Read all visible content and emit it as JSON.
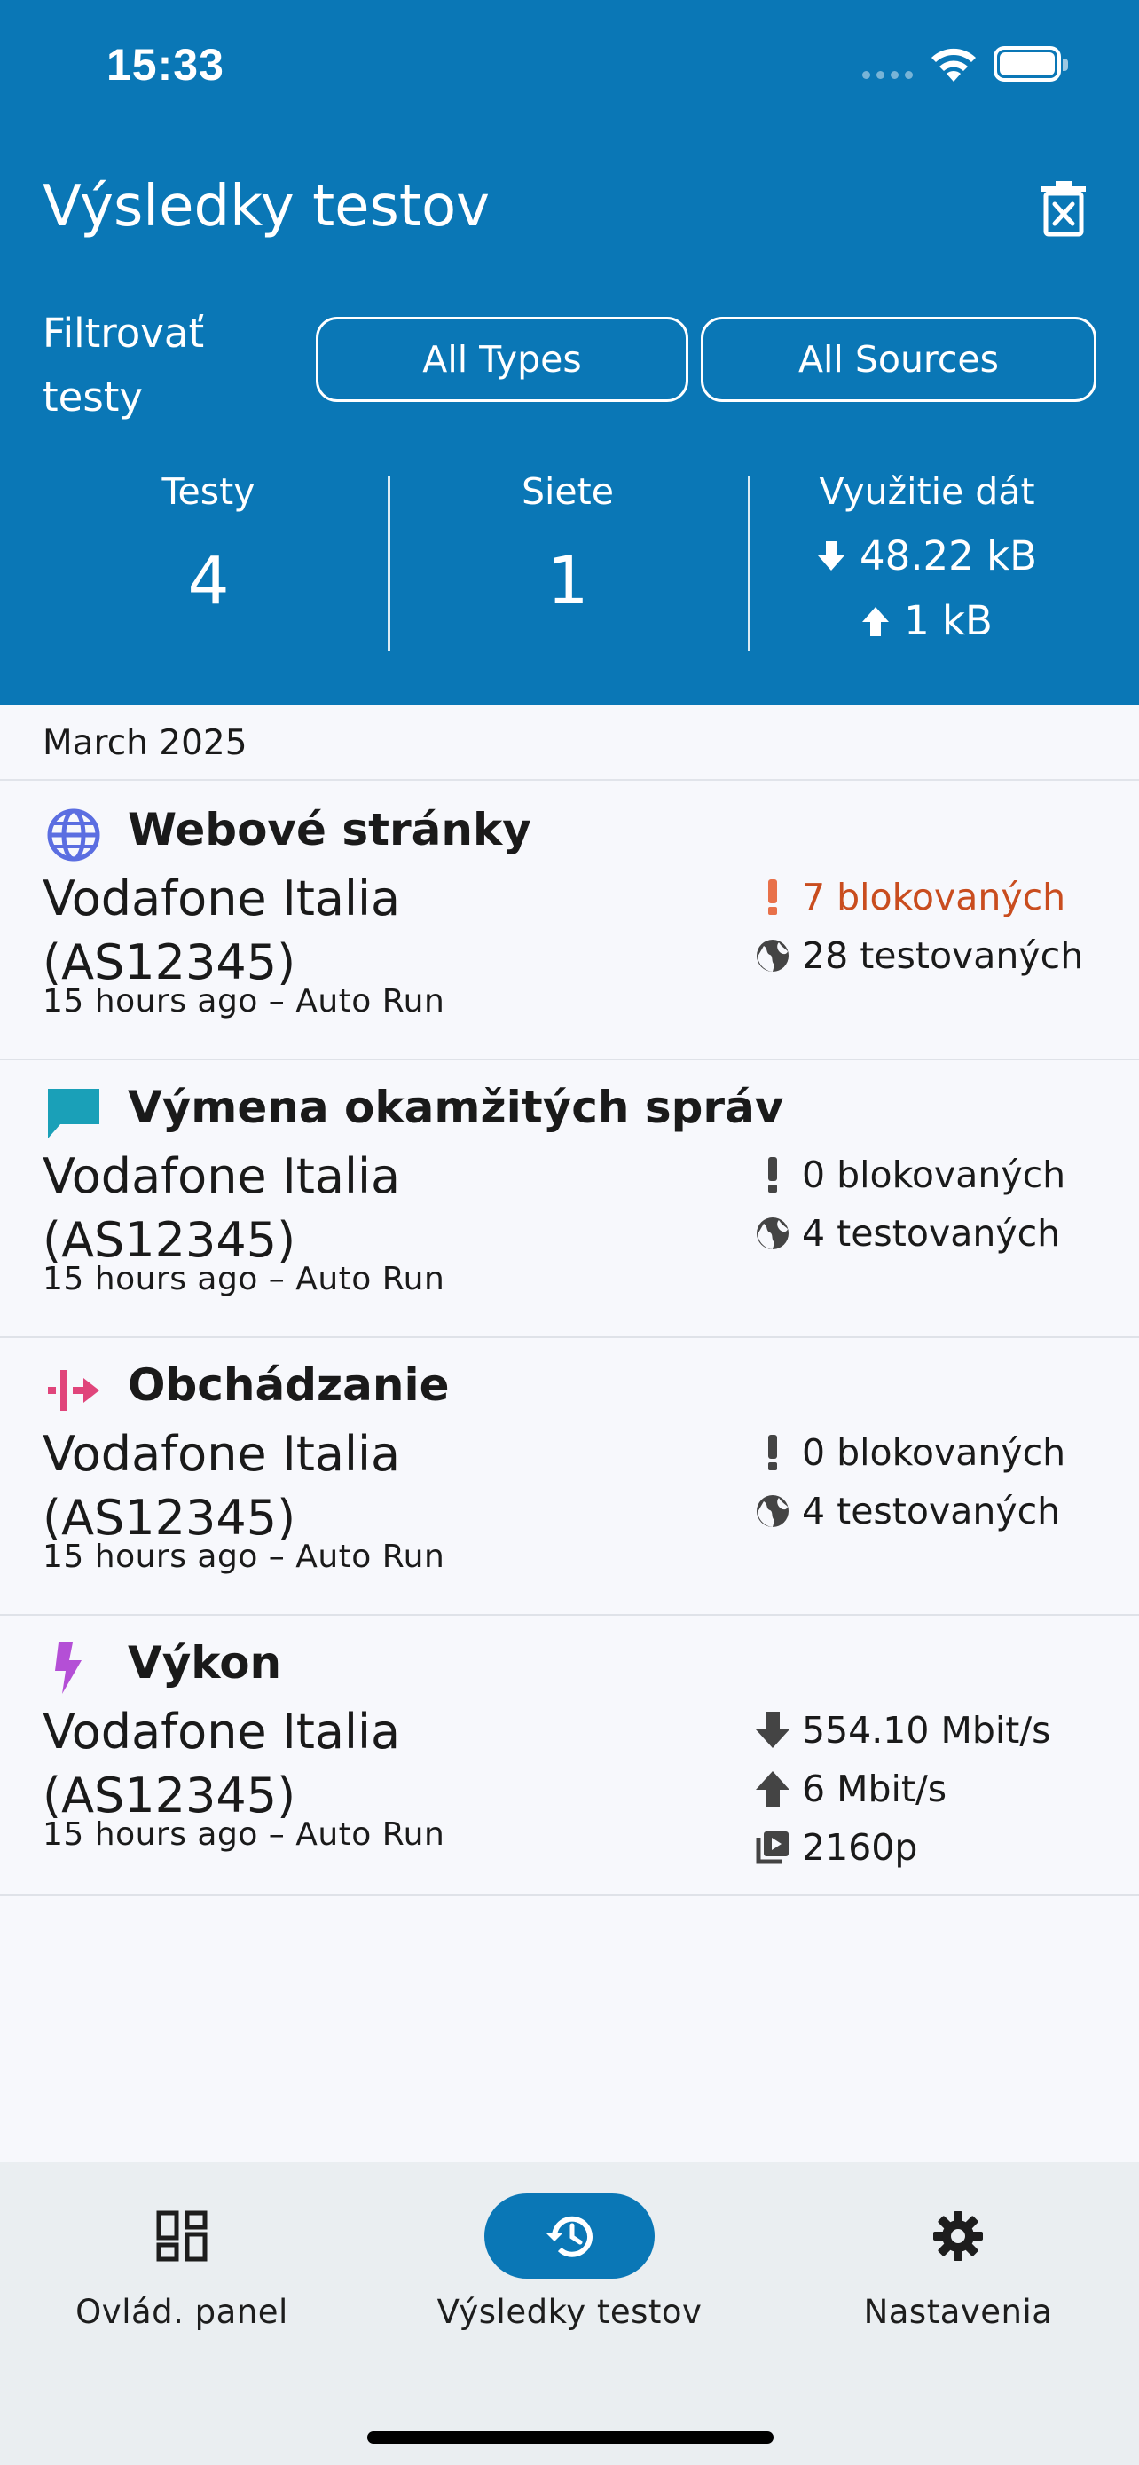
{
  "status_bar": {
    "time": "15:33"
  },
  "header": {
    "title": "Výsledky testov",
    "filter_label": "Filtrovať testy",
    "filter_types": "All Types",
    "filter_sources": "All Sources",
    "stats": {
      "tests_label": "Testy",
      "tests_value": "4",
      "networks_label": "Siete",
      "networks_value": "1",
      "data_label": "Využitie dát",
      "data_download": "48.22 kB",
      "data_upload": "1 kB"
    }
  },
  "month_header": "March 2025",
  "results": [
    {
      "icon": "globe-icon",
      "icon_color": "#5b6ee1",
      "title": "Webové stránky",
      "network": "Vodafone Italia (AS12345)",
      "meta": "15 hours ago – Auto Run",
      "metrics": [
        {
          "icon": "exclamation-icon",
          "text": "7 blokovaných",
          "color": "#c94d1f"
        },
        {
          "icon": "world-icon",
          "text": "28 testovaných"
        }
      ]
    },
    {
      "icon": "chat-icon",
      "icon_color": "#1aa0b8",
      "title": "Výmena okamžitých správ",
      "network": "Vodafone Italia (AS12345)",
      "meta": "15 hours ago – Auto Run",
      "metrics": [
        {
          "icon": "exclamation-icon",
          "text": "0 blokovaných"
        },
        {
          "icon": "world-icon",
          "text": "4 testovaných"
        }
      ]
    },
    {
      "icon": "circumvention-icon",
      "icon_color": "#e0457b",
      "title": "Obchádzanie",
      "network": "Vodafone Italia (AS12345)",
      "meta": "15 hours ago – Auto Run",
      "metrics": [
        {
          "icon": "exclamation-icon",
          "text": "0 blokovaných"
        },
        {
          "icon": "world-icon",
          "text": "4 testovaných"
        }
      ]
    },
    {
      "icon": "lightning-icon",
      "icon_color": "#b44fd6",
      "title": "Výkon",
      "network": "Vodafone Italia (AS12345)",
      "meta": "15 hours ago – Auto Run",
      "metrics": [
        {
          "icon": "download-arrow-icon",
          "text": "554.10 Mbit/s"
        },
        {
          "icon": "upload-arrow-icon",
          "text": "6 Mbit/s"
        },
        {
          "icon": "video-icon",
          "text": "2160p"
        }
      ]
    }
  ],
  "tabbar": {
    "dashboard": "Ovlád. panel",
    "results": "Výsledky testov",
    "settings": "Nastavenia"
  },
  "colors": {
    "brand": "#0a77b6",
    "alert": "#c94d1f",
    "background": "#f7f8fc"
  }
}
